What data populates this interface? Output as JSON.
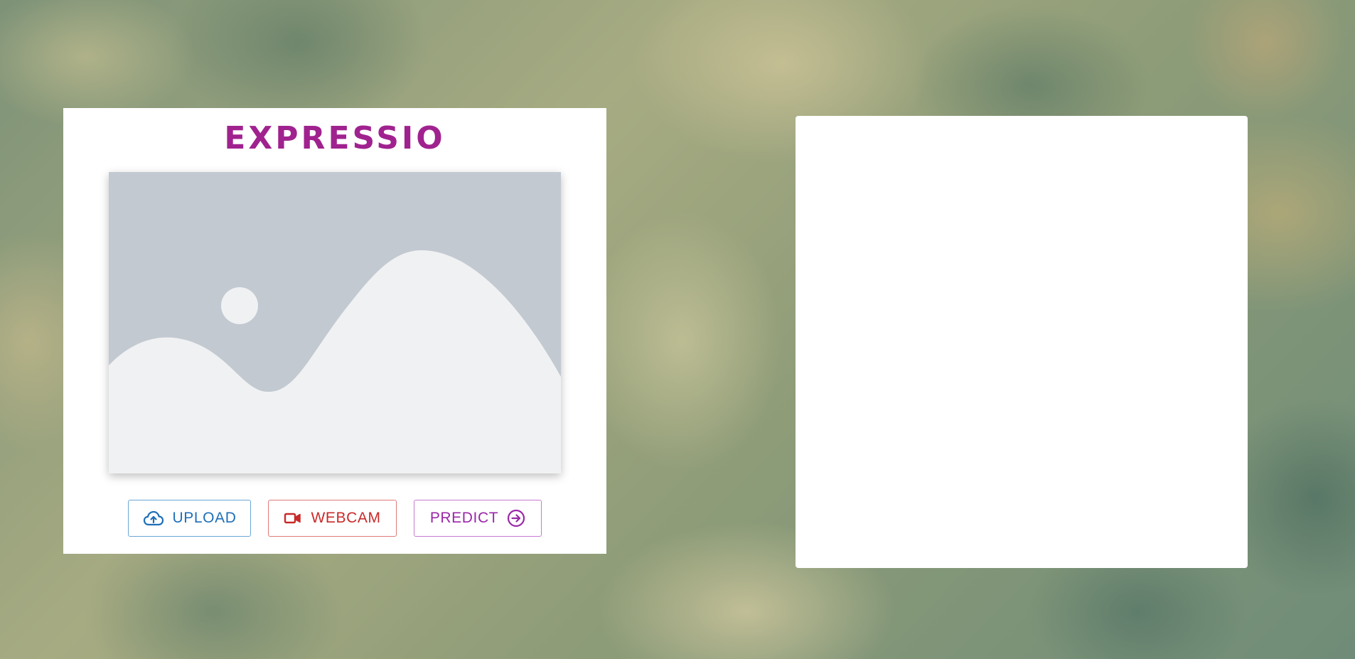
{
  "app": {
    "title": "EXPRESSIO"
  },
  "image_preview": {
    "icon": "image-placeholder-icon"
  },
  "buttons": {
    "upload": {
      "label": "UPLOAD",
      "icon": "cloud-upload-icon",
      "color": "#1f6fb8"
    },
    "webcam": {
      "label": "WEBCAM",
      "icon": "video-camera-icon",
      "color": "#c92a2a"
    },
    "predict": {
      "label": "PREDICT",
      "icon": "arrow-circle-right-icon",
      "color": "#9b27a8"
    }
  },
  "colors": {
    "title": "#a0228f",
    "placeholder_bg": "#c2c9d0",
    "placeholder_fg": "#f0f1f3"
  }
}
